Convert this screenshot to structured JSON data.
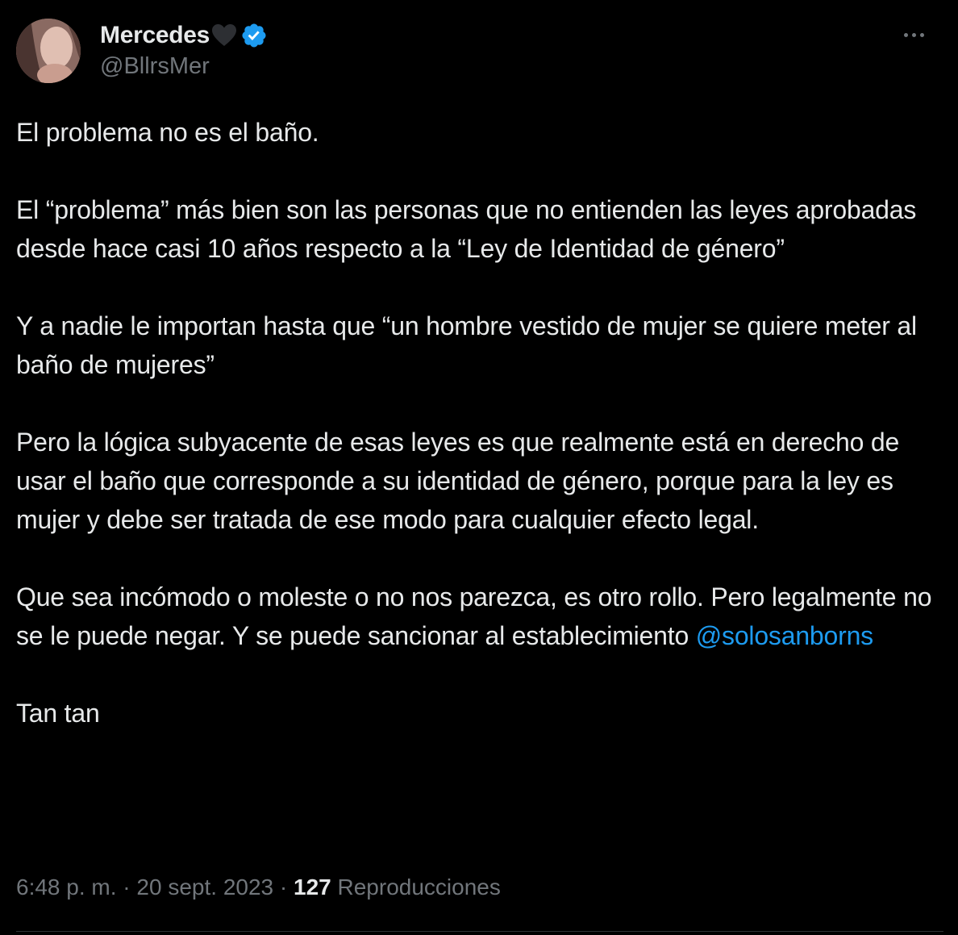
{
  "author": {
    "display_name": "Mercedes",
    "name_emoji": "black-heart-icon",
    "verified": true,
    "handle": "@BllrsMer"
  },
  "colors": {
    "background": "#000000",
    "text": "#e7e9ea",
    "secondary": "#71767b",
    "link": "#1d9bf0"
  },
  "tweet": {
    "paragraphs": [
      "El problema no es el baño.",
      "El “problema” más bien son las personas que no entienden las leyes aprobadas desde hace casi 10 años respecto a la “Ley de Identidad de género”",
      "Y  a nadie le importan hasta que “un hombre vestido de mujer se quiere meter al baño de mujeres”",
      "Pero la lógica subyacente de esas leyes es que realmente está en derecho de usar el baño que corresponde  a su identidad de género, porque para la ley es mujer y debe ser tratada de ese modo para cualquier efecto legal."
    ],
    "para5_text": "Que sea incómodo o moleste o no nos parezca, es otro rollo. Pero legalmente no se le puede negar. Y se puede sancionar al establecimiento ",
    "para5_mention": "@solosanborns",
    "closing": "Tan tan"
  },
  "meta": {
    "time": "6:48 p. m.",
    "separator": "·",
    "date": "20 sept. 2023",
    "views_count": "127",
    "views_label": "Reproducciones"
  }
}
